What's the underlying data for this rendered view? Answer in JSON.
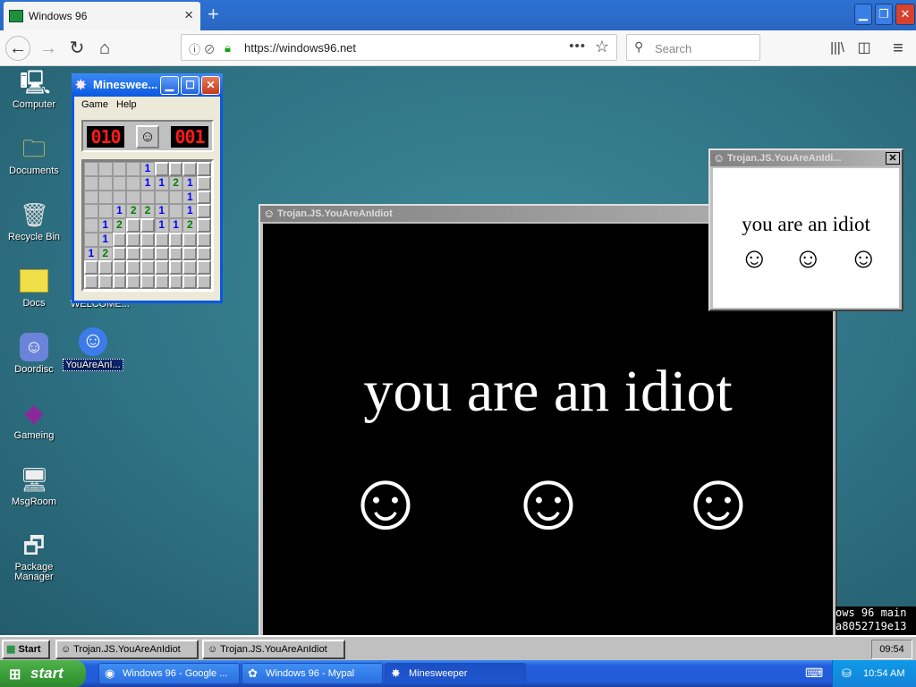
{
  "browser": {
    "tab_title": "Windows 96",
    "new_tab_icon": "+",
    "url": "https://windows96.net",
    "search_placeholder": "Search"
  },
  "desktop_icons": [
    {
      "label": "Computer",
      "icon": "computer-icon"
    },
    {
      "label": "Documents",
      "icon": "folder-icon"
    },
    {
      "label": "Recycle Bin",
      "icon": "recycle-bin-icon"
    },
    {
      "label": "Docs",
      "icon": "folder-icon"
    },
    {
      "label": "Doordisc",
      "icon": "doordisc-icon"
    },
    {
      "label": "Gameing",
      "icon": "game-icon"
    },
    {
      "label": "MsgRoom",
      "icon": "msgroom-icon"
    },
    {
      "label": "Package\nManager",
      "icon": "package-icon"
    },
    {
      "label": "WELCOME...",
      "icon": "document-icon"
    },
    {
      "label": "YouAreAnI...",
      "icon": "smiley-icon"
    }
  ],
  "minesweeper": {
    "title": "Minesweeper",
    "title_short": "Minesweе...",
    "menu": [
      "Game",
      "Help"
    ],
    "mine_counter": "010",
    "timer": "001",
    "grid": [
      [
        "",
        "",
        "",
        "",
        "1",
        "o",
        "o",
        "o",
        "o"
      ],
      [
        "",
        "",
        "",
        "",
        "1",
        "1",
        "2",
        "1",
        "o"
      ],
      [
        "",
        "",
        "",
        "",
        "",
        "",
        "",
        "1",
        "o"
      ],
      [
        "",
        "",
        "1",
        "2",
        "2",
        "1",
        "",
        "1",
        "o"
      ],
      [
        "",
        "1",
        "2",
        "o",
        "o",
        "1",
        "1",
        "2",
        "o"
      ],
      [
        "",
        "1",
        "o",
        "o",
        "o",
        "o",
        "o",
        "o",
        "o"
      ],
      [
        "1",
        "2",
        "o",
        "o",
        "o",
        "o",
        "o",
        "o",
        "o"
      ],
      [
        "o",
        "o",
        "o",
        "o",
        "o",
        "o",
        "o",
        "o",
        "o"
      ],
      [
        "o",
        "o",
        "o",
        "o",
        "o",
        "o",
        "o",
        "o",
        "o"
      ]
    ]
  },
  "popup_large": {
    "title": "Trojan.JS.YouAreAnIdiot",
    "message": "you are an idiot"
  },
  "popup_small": {
    "title": "Trojan.JS.YouAreAnIdi...",
    "message": "you are an idiot"
  },
  "terminal": {
    "line1": "ows 96 main",
    "line2": "a8052719e13"
  },
  "win96_taskbar": {
    "start": "Start",
    "items": [
      "Trojan.JS.YouAreAnIdiot",
      "Trojan.JS.YouAreAnIdiot"
    ],
    "clock": "09:54"
  },
  "xp_taskbar": {
    "start": "start",
    "items": [
      "Windows 96 - Google ...",
      "Windows 96 - Mypal",
      "Minesweeper"
    ],
    "clock": "10:54 AM"
  }
}
